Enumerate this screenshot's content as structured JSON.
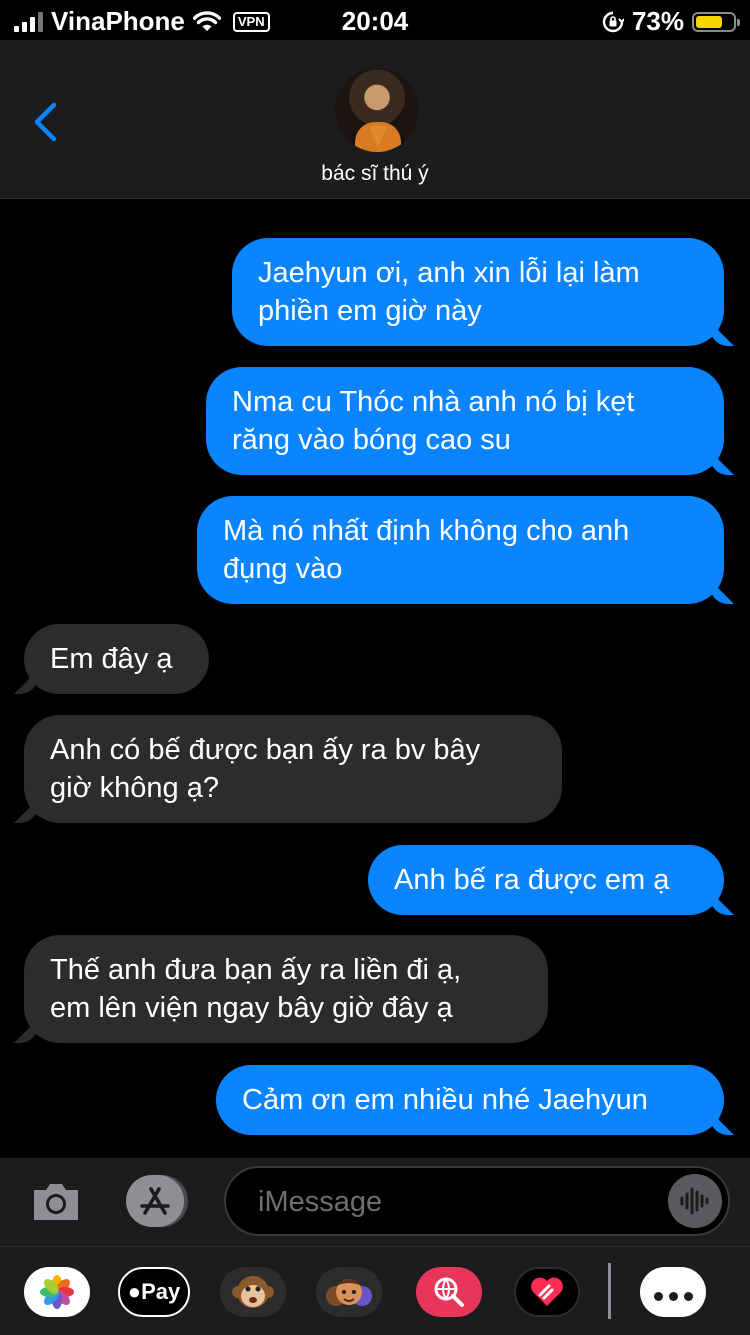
{
  "status_bar": {
    "carrier": "VinaPhone",
    "vpn": "VPN",
    "time": "20:04",
    "battery": "73%",
    "battery_level": 0.73,
    "battery_color": "#f5d400"
  },
  "header": {
    "contact_name": "bác sĩ thú ý",
    "back_icon": "chevron-left-icon",
    "avatar_icon": "contact-avatar"
  },
  "messages": [
    {
      "direction": "outgoing",
      "text": "Jaehyun ơi, anh xin lỗi lại làm\nphiền em giờ này"
    },
    {
      "direction": "outgoing",
      "text": "Nma cu Thóc nhà anh nó bị kẹt\nrăng vào bóng cao su"
    },
    {
      "direction": "outgoing",
      "text": "Mà nó nhất định không cho anh\nđụng vào"
    },
    {
      "direction": "incoming",
      "text": "Em đây ạ"
    },
    {
      "direction": "incoming",
      "text": "Anh có bế được bạn ấy ra bv bây\ngiờ không ạ?"
    },
    {
      "direction": "outgoing",
      "text": "Anh bế ra được em ạ"
    },
    {
      "direction": "incoming",
      "text": "Thế anh đưa bạn ấy ra liền đi ạ,\nem lên viện ngay bây giờ đây ạ"
    },
    {
      "direction": "outgoing",
      "text": "Cảm ơn em nhiều nhé Jaehyun"
    }
  ],
  "input_bar": {
    "placeholder": "iMessage",
    "value": "",
    "camera_icon": "camera-icon",
    "appstore_icon": "app-store-icon",
    "audio_icon": "waveform-icon"
  },
  "tray": {
    "items": [
      "photos-icon",
      "apple-pay",
      "animoji-monkey-icon",
      "memoji-icon",
      "web-search-icon",
      "digital-touch-icon",
      "more-icon"
    ],
    "apple_pay_label": "Pay"
  },
  "colors": {
    "outgoing_bubble": "#0a84ff",
    "incoming_bubble": "#2c2c2e",
    "background": "#000000",
    "bar_background": "#1c1c1e"
  }
}
